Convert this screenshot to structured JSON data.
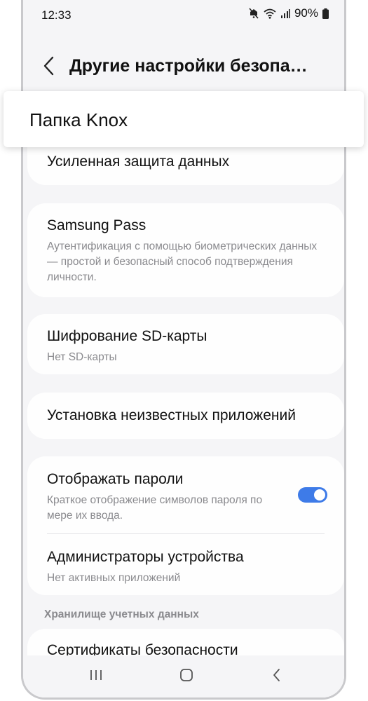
{
  "status_bar": {
    "time": "12:33",
    "battery": "90%"
  },
  "header": {
    "title": "Другие настройки безопа…"
  },
  "popup": {
    "label": "Папка Knox"
  },
  "items": {
    "enhanced_protection": {
      "title": "Усиленная защита данных"
    },
    "samsung_pass": {
      "title": "Samsung Pass",
      "subtitle": "Аутентификация с помощью биометрических данных — простой и безопасный способ подтверждения личности."
    },
    "sd_encryption": {
      "title": "Шифрование SD-карты",
      "subtitle": "Нет SD-карты"
    },
    "unknown_apps": {
      "title": "Установка неизвестных приложений"
    },
    "show_passwords": {
      "title": "Отображать пароли",
      "subtitle": "Краткое отображение символов пароля по мере их ввода.",
      "toggle_on": true
    },
    "device_admins": {
      "title": "Администраторы устройства",
      "subtitle": "Нет активных приложений"
    },
    "security_certs": {
      "title": "Сертификаты безопасности"
    }
  },
  "section": {
    "credential_storage": "Хранилище учетных данных"
  },
  "colors": {
    "accent": "#3e7be8",
    "background": "#f5f5f7",
    "card": "#fefefe"
  },
  "icons": {
    "status": [
      "mute-icon",
      "wifi-icon",
      "signal-icon",
      "battery-icon"
    ],
    "nav": [
      "recents-icon",
      "home-icon",
      "back-nav-icon"
    ]
  }
}
